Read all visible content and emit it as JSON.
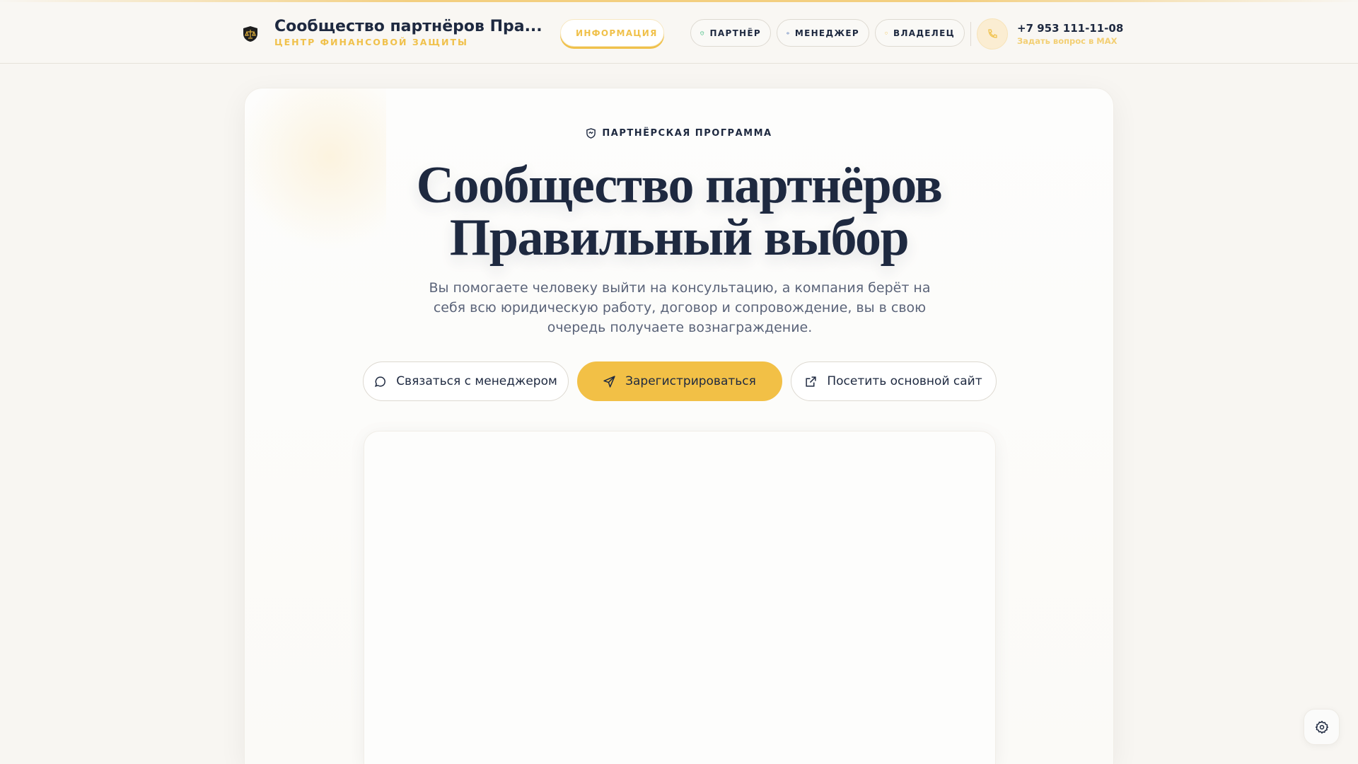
{
  "header": {
    "title": "Сообщество партнёров Пра...",
    "subtitle": "ЦЕНТР ФИНАНСОВОЙ ЗАЩИТЫ",
    "nav": [
      {
        "label": "ИНФОРМАЦИЯ",
        "icon": "info-icon"
      },
      {
        "label": "ПАРТНЁР",
        "icon": "handshake-icon"
      },
      {
        "label": "МЕНЕДЖЕР",
        "icon": "eye-icon"
      },
      {
        "label": "ВЛАДЕЛЕЦ",
        "icon": "shield-icon"
      }
    ],
    "phone": "+7 953 111-11-08",
    "phone_sub": "Задать вопрос в MAX"
  },
  "hero": {
    "label": "ПАРТНЁРСКАЯ ПРОГРАММА",
    "title_line1": "Сообщество партнёров",
    "title_line2": "Правильный выбор",
    "lead": "Вы помогаете человеку выйти на консультацию, а компания берёт на себя всю юридическую работу, договор и сопровождение, вы в свою очередь получаете вознаграждение.",
    "buttons": [
      {
        "label": "Связаться с менеджером",
        "icon": "chat-icon"
      },
      {
        "label": "Зарегистрироваться",
        "icon": "send-icon"
      },
      {
        "label": "Посетить основной сайт",
        "icon": "external-link-icon"
      }
    ]
  },
  "colors": {
    "accent": "#f2c046",
    "text": "#1e2940",
    "muted": "#5b6479"
  }
}
